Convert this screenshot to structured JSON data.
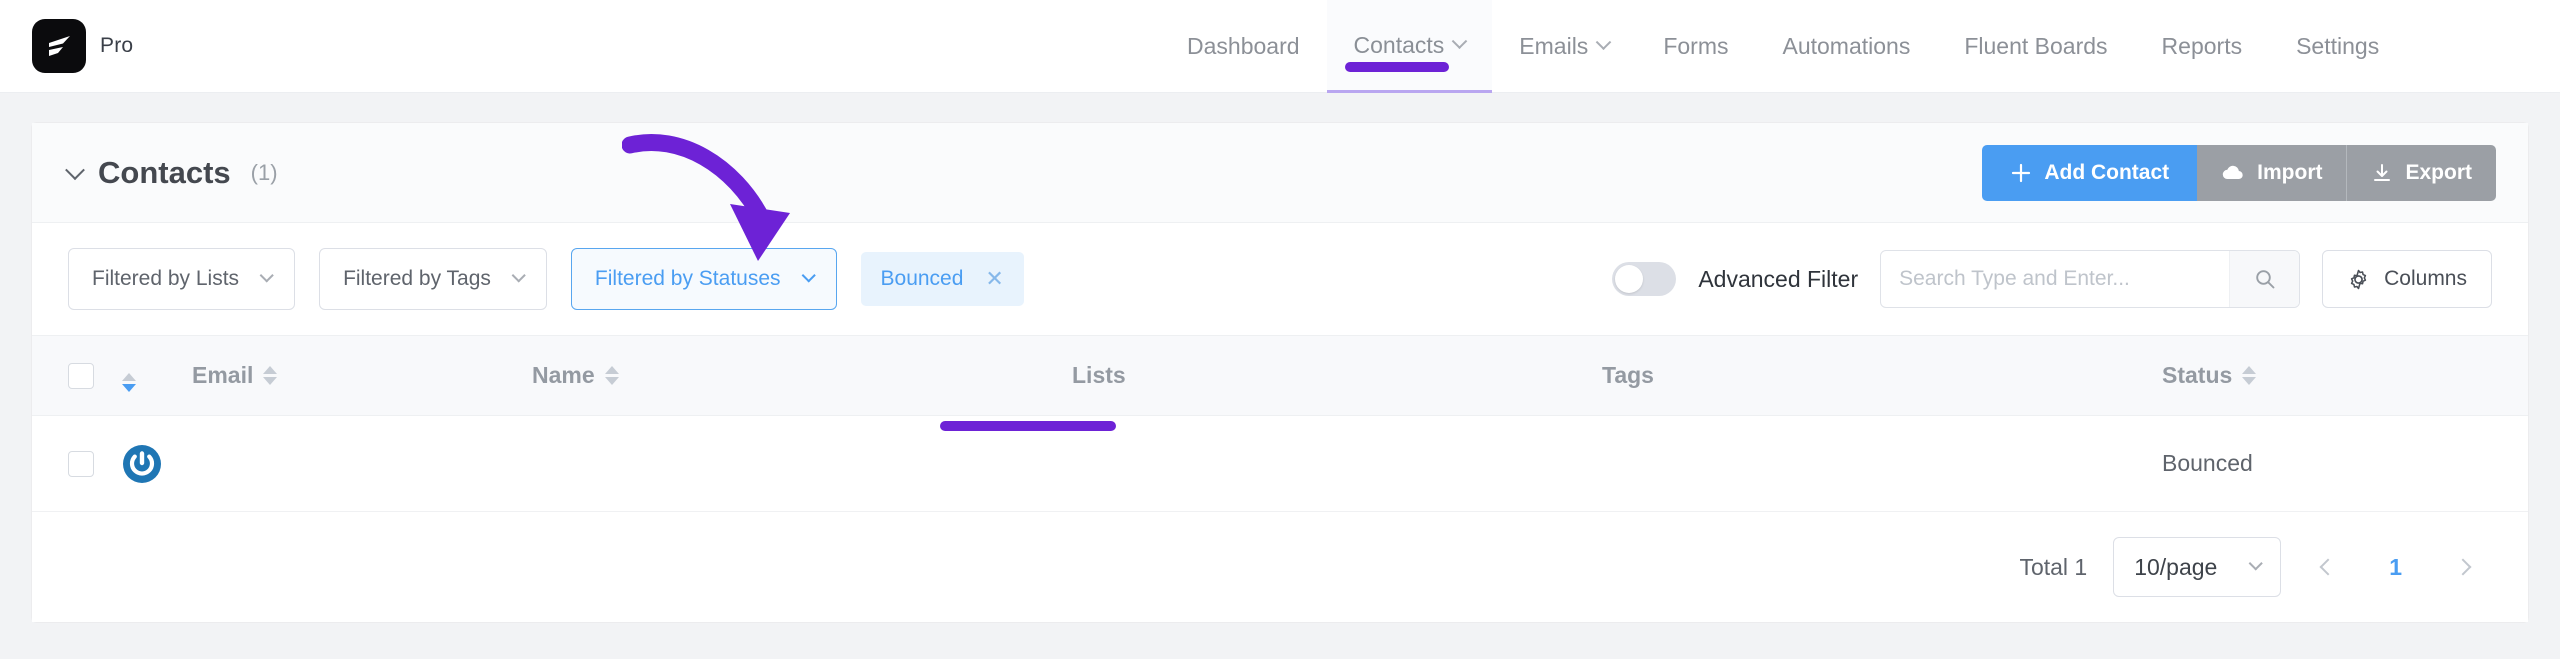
{
  "brand": {
    "pro_label": "Pro",
    "logo_icon": "fluentcrm-logo-icon"
  },
  "nav": {
    "items": [
      {
        "label": "Dashboard",
        "has_chevron": false,
        "active": false
      },
      {
        "label": "Contacts",
        "has_chevron": true,
        "active": true
      },
      {
        "label": "Emails",
        "has_chevron": true,
        "active": false
      },
      {
        "label": "Forms",
        "has_chevron": false,
        "active": false
      },
      {
        "label": "Automations",
        "has_chevron": false,
        "active": false
      },
      {
        "label": "Fluent Boards",
        "has_chevron": false,
        "active": false
      },
      {
        "label": "Reports",
        "has_chevron": false,
        "active": false
      },
      {
        "label": "Settings",
        "has_chevron": false,
        "active": false
      }
    ]
  },
  "header": {
    "title": "Contacts",
    "count": "(1)",
    "add_contact_label": "Add Contact",
    "import_label": "Import",
    "export_label": "Export"
  },
  "filters": {
    "lists_label": "Filtered by Lists",
    "tags_label": "Filtered by Tags",
    "statuses_label": "Filtered by Statuses",
    "active_chip": "Bounced",
    "chip_close_icon": "close-icon",
    "advanced_filter_label": "Advanced Filter",
    "advanced_filter_on": false,
    "search_placeholder": "Search Type and Enter...",
    "search_value": "",
    "columns_label": "Columns"
  },
  "table": {
    "columns": [
      "Email",
      "Name",
      "Lists",
      "Tags",
      "Status"
    ],
    "rows": [
      {
        "email": "",
        "email_redacted": true,
        "name": "",
        "lists": "",
        "tags": "",
        "status": "Bounced",
        "avatar_icon": "gravatar-icon"
      }
    ]
  },
  "pagination": {
    "total_label": "Total 1",
    "per_page": "10/page",
    "current_page": "1"
  },
  "annotations": {
    "arrow_color": "#6d22d6",
    "underline_color": "#6d22d6"
  },
  "colors": {
    "primary_blue": "#4a9df2",
    "grey_button": "#9b9fa5",
    "accent_purple": "#6d22d6"
  }
}
